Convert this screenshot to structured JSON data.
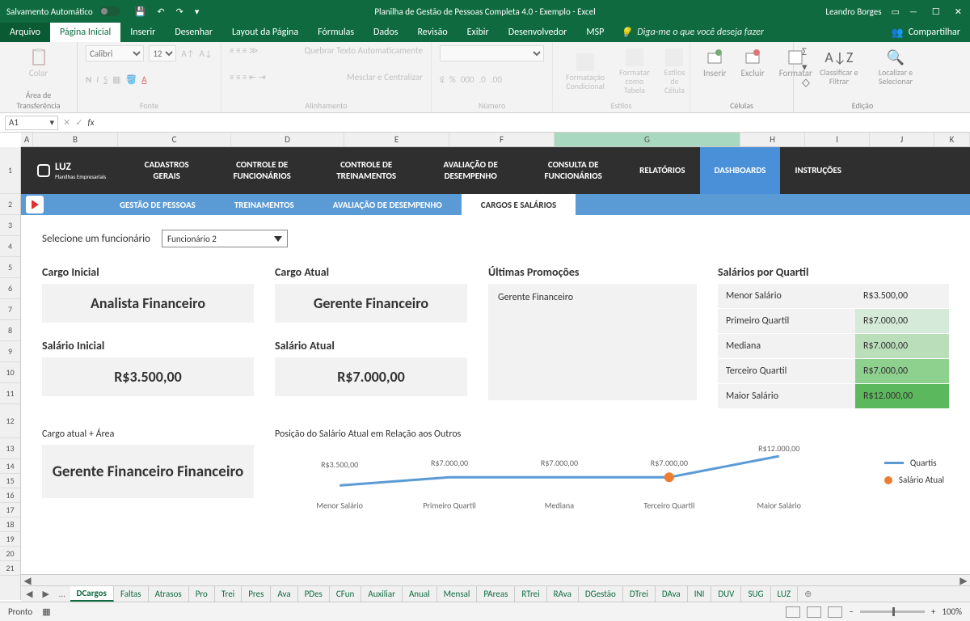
{
  "titlebar": {
    "autosave": "Salvamento Automático",
    "title": "Planilha de Gestão de Pessoas Completa 4.0 - Exemplo  -  Excel",
    "user": "Leandro Borges"
  },
  "menu": {
    "items": [
      "Arquivo",
      "Página Inicial",
      "Inserir",
      "Desenhar",
      "Layout da Página",
      "Fórmulas",
      "Dados",
      "Revisão",
      "Exibir",
      "Desenvolvedor",
      "MSP"
    ],
    "tell": "Diga-me o que você deseja fazer",
    "share": "Compartilhar"
  },
  "ribbon": {
    "clipboard": {
      "paste": "Colar",
      "label": "Área de Transferência"
    },
    "font": {
      "name": "Calibri",
      "size": "12",
      "label": "Fonte"
    },
    "align": {
      "wrap": "Quebrar Texto Automaticamente",
      "merge": "Mesclar e Centralizar",
      "label": "Alinhamento"
    },
    "number": {
      "label": "Número"
    },
    "styles": {
      "cond": "Formatação Condicional",
      "table": "Formatar como Tabela",
      "cell": "Estilos de Célula",
      "label": "Estilos"
    },
    "cells": {
      "insert": "Inserir",
      "delete": "Excluir",
      "format": "Formatar",
      "label": "Células"
    },
    "editing": {
      "sort": "Classificar e Filtrar",
      "find": "Localizar e Selecionar",
      "label": "Edição"
    }
  },
  "cellref": "A1",
  "cols": [
    "A",
    "B",
    "C",
    "D",
    "E",
    "F",
    "G",
    "H",
    "I",
    "J",
    "K"
  ],
  "rows": [
    "1",
    "2",
    "3",
    "4",
    "5",
    "6",
    "7",
    "8",
    "9",
    "10",
    "11",
    "12",
    "13",
    "14",
    "15",
    "16",
    "17",
    "18",
    "19",
    "20",
    "21"
  ],
  "nav": {
    "logo_t": "LUZ",
    "logo_s": "Planilhas Empresariais",
    "items": [
      "CADASTROS GERAIS",
      "CONTROLE DE FUNCIONÁRIOS",
      "CONTROLE DE TREINAMENTOS",
      "AVALIAÇÃO DE DESEMPENHO",
      "CONSULTA DE FUNCIONÁRIOS",
      "RELATÓRIOS",
      "DASHBOARDS",
      "INSTRUÇÕES"
    ]
  },
  "subnav": {
    "items": [
      "GESTÃO DE PESSOAS",
      "TREINAMENTOS",
      "AVALIAÇÃO DE DESEMPENHO",
      "CARGOS E SALÁRIOS"
    ]
  },
  "sel": {
    "label": "Selecione um funcionário",
    "value": "Funcionário 2"
  },
  "cards": {
    "cargo_inicial": {
      "label": "Cargo Inicial",
      "value": "Analista Financeiro"
    },
    "cargo_atual": {
      "label": "Cargo Atual",
      "value": "Gerente Financeiro"
    },
    "sal_inicial": {
      "label": "Salário Inicial",
      "value": "R$3.500,00"
    },
    "sal_atual": {
      "label": "Salário Atual",
      "value": "R$7.000,00"
    },
    "promo": {
      "label": "Últimas Promoções",
      "value": "Gerente Financeiro"
    },
    "quartil": {
      "label": "Salários por Quartil",
      "rows": [
        {
          "k": "Menor Salário",
          "v": "R$3.500,00",
          "c": "g0"
        },
        {
          "k": "Primeiro Quartil",
          "v": "R$7.000,00",
          "c": "g1"
        },
        {
          "k": "Mediana",
          "v": "R$7.000,00",
          "c": "g2"
        },
        {
          "k": "Terceiro Quartil",
          "v": "R$7.000,00",
          "c": "g3"
        },
        {
          "k": "Maior Salário",
          "v": "R$12.000,00",
          "c": "g4"
        }
      ]
    },
    "cargo_area": {
      "label": "Cargo atual + Área",
      "value": "Gerente Financeiro Financeiro"
    },
    "posicao": {
      "label": "Posição do Salário Atual em Relação aos Outros"
    }
  },
  "chart_data": {
    "type": "line",
    "categories": [
      "Menor Salário",
      "Primeiro Quartil",
      "Mediana",
      "Terceiro Quartil",
      "Maior Salário"
    ],
    "values": [
      3500,
      7000,
      7000,
      7000,
      12000
    ],
    "value_labels": [
      "R$3.500,00",
      "R$7.000,00",
      "R$7.000,00",
      "R$7.000,00",
      "R$12.000,00"
    ],
    "series_name": "Quartis",
    "marker": {
      "name": "Salário Atual",
      "category": "Terceiro Quartil",
      "value": 7000
    }
  },
  "sheet_tabs": [
    "DCargos",
    "Faltas",
    "Atrasos",
    "Pro",
    "Trei",
    "Pres",
    "Ava",
    "PDes",
    "CFun",
    "Auxiliar",
    "Anual",
    "Mensal",
    "PAreas",
    "RTrei",
    "RAva",
    "DGestão",
    "DTrei",
    "DAva",
    "INI",
    "DUV",
    "SUG",
    "LUZ"
  ],
  "status": {
    "ready": "Pronto",
    "zoom": "100%"
  }
}
